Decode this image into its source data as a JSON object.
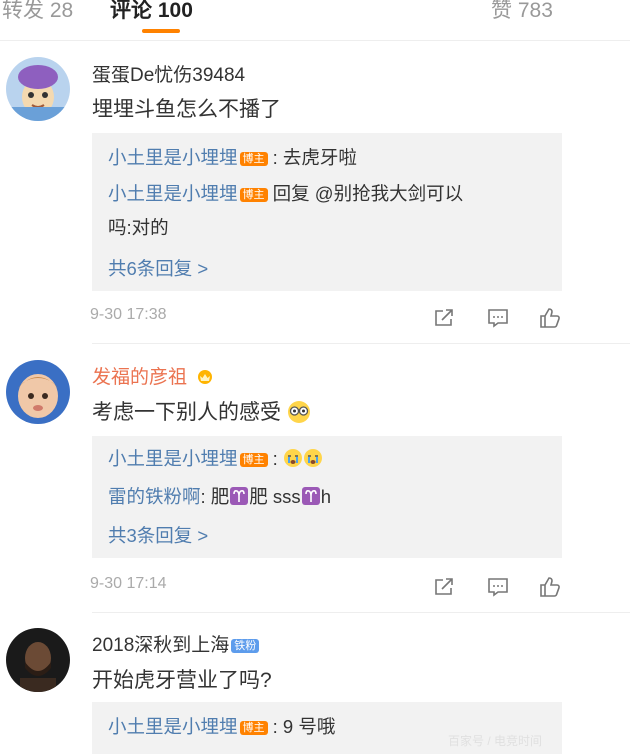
{
  "tabs": {
    "repost": "转发 28",
    "comments": "评论 100",
    "likes": "赞 783"
  },
  "comments": [
    {
      "username": "蛋蛋De忧伤39484",
      "text": "埋埋斗鱼怎么不播了",
      "time": "9-30 17:38",
      "replies": [
        {
          "user": "小土里是小埋埋",
          "badge": "博主",
          "text": ": 去虎牙啦"
        },
        {
          "user": "小土里是小埋埋",
          "badge": "博主",
          "text": "回复 @别抢我大剑可以",
          "text2": "吗:对的"
        }
      ],
      "more": "共6条回复 >"
    },
    {
      "username": "发福的彦祖",
      "text": "考虑一下别人的感受",
      "time": "9-30 17:14",
      "replies": [
        {
          "user": "小土里是小埋埋",
          "badge": "博主",
          "text": ":"
        },
        {
          "user": "雷的铁粉啊",
          "text": ": 肥",
          "text_b": "肥 sss",
          "text_c": "h"
        }
      ],
      "more": "共3条回复 >"
    },
    {
      "username": "2018深秋到上海",
      "badge": "铁粉",
      "text": "开始虎牙营业了吗?",
      "replies": [
        {
          "user": "小土里是小埋埋",
          "badge": "博主",
          "text": ": 9 号哦"
        }
      ]
    }
  ],
  "watermark": "百家号 / 电竞时间"
}
